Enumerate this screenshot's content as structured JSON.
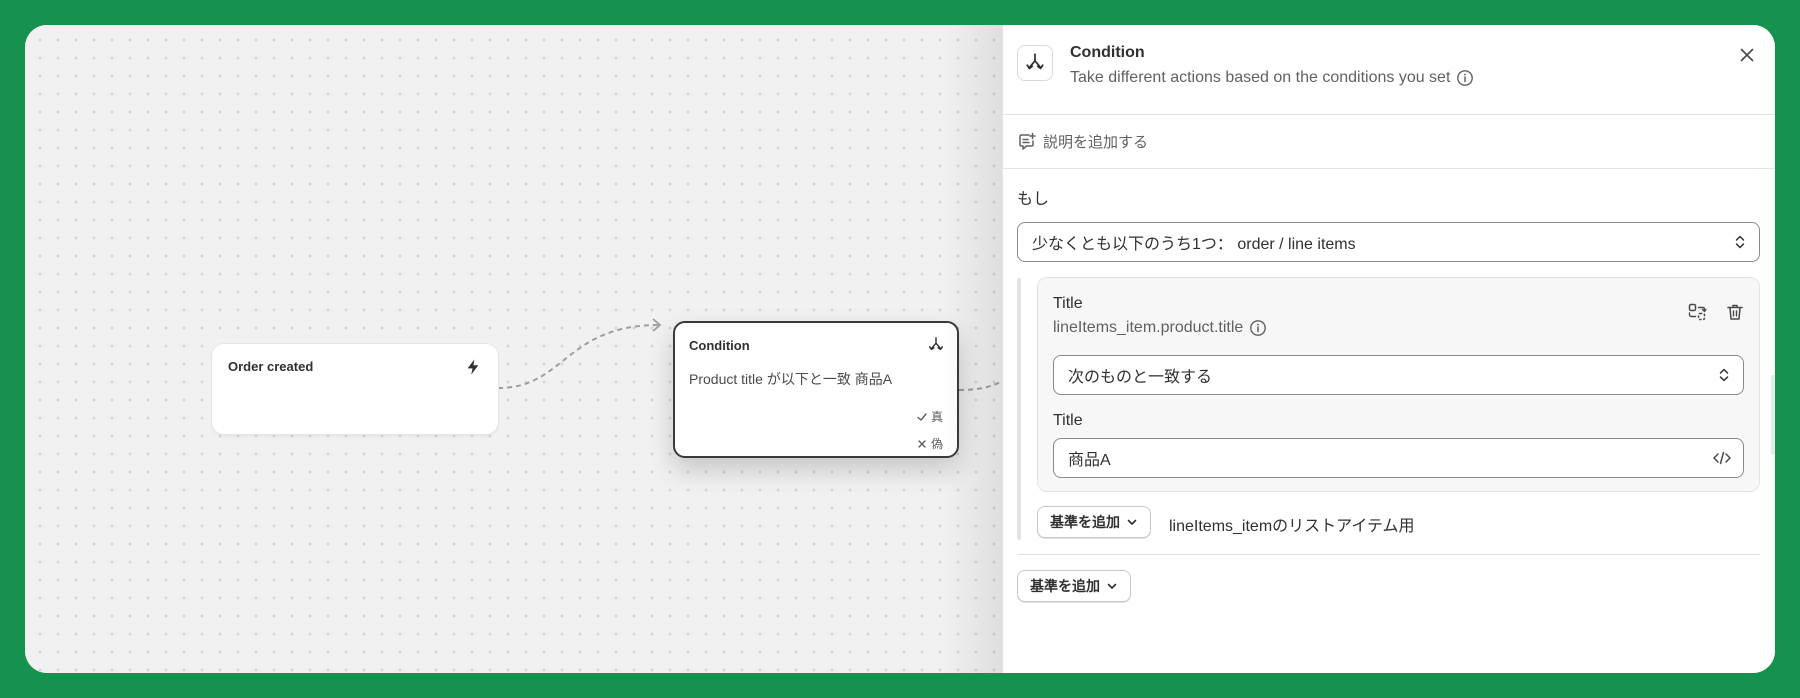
{
  "canvas": {
    "trigger_node": {
      "title": "Order created",
      "icon": "lightning-icon"
    },
    "condition_node": {
      "title": "Condition",
      "icon": "branch-icon",
      "description": "Product title が以下と一致 商品A",
      "true_label": "真",
      "false_label": "偽"
    }
  },
  "panel": {
    "title": "Condition",
    "subtitle": "Take different actions based on the conditions you set",
    "add_description": "説明を追加する",
    "if_label": "もし",
    "scope_select": "少なくとも以下のうち1つ： order / line items",
    "criteria": {
      "title": "Title",
      "path": "lineItems_item.product.title",
      "operator": "次のものと一致する",
      "value_label": "Title",
      "value": "商品A"
    },
    "inner_add_button": "基準を追加",
    "inner_add_note": "lineItems_itemのリストアイテム用",
    "outer_add_button": "基準を追加"
  },
  "colors": {
    "background": "#15924d",
    "canvas": "#f1f1f1",
    "panel": "#ffffff",
    "text": "#303030"
  }
}
